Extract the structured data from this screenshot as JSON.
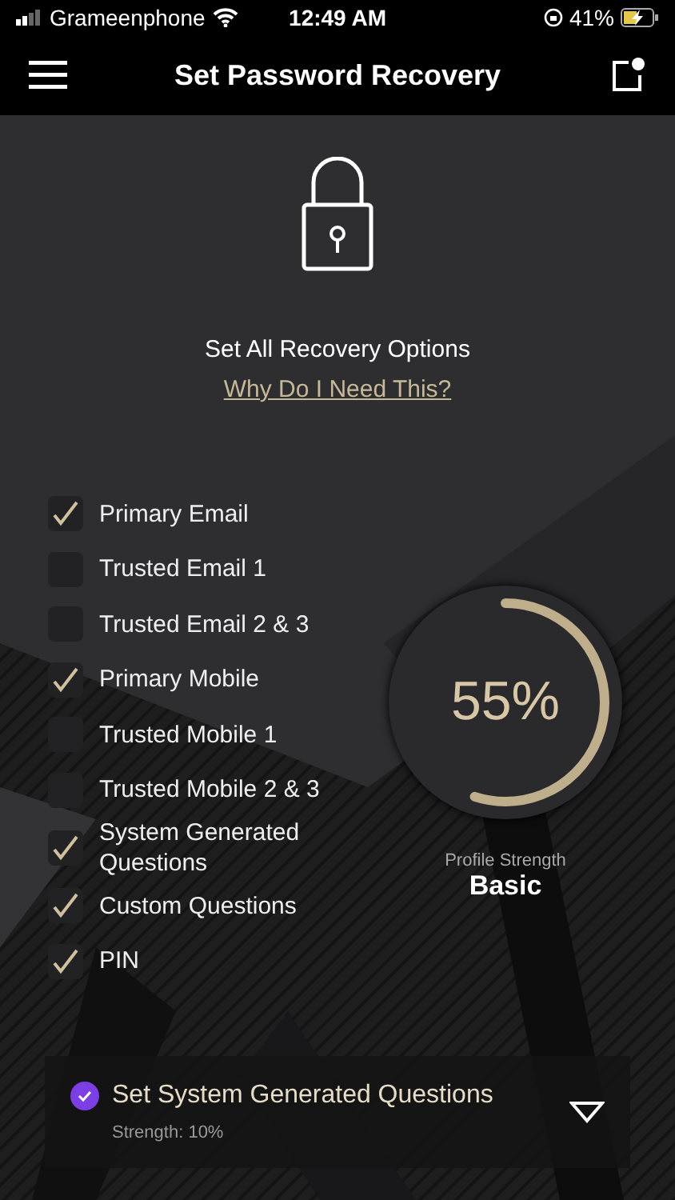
{
  "status_bar": {
    "carrier": "Grameenphone",
    "time": "12:49 AM",
    "battery": "41%"
  },
  "nav_bar": {
    "title": "Set Password Recovery"
  },
  "header": {
    "title": "Set All Recovery Options",
    "link": "Why Do I Need This?"
  },
  "options": [
    {
      "label": "Primary Email",
      "checked": true
    },
    {
      "label": "Trusted Email 1",
      "checked": false
    },
    {
      "label": "Trusted Email 2 & 3",
      "checked": false
    },
    {
      "label": "Primary Mobile",
      "checked": true
    },
    {
      "label": "Trusted Mobile 1",
      "checked": false
    },
    {
      "label": "Trusted Mobile 2 & 3",
      "checked": false
    },
    {
      "label": "System Generated Questions",
      "checked": true
    },
    {
      "label": "Custom Questions",
      "checked": true
    },
    {
      "label": "PIN",
      "checked": true
    }
  ],
  "profile_strength": {
    "level": 0.55,
    "percent": "55%",
    "caption": "Profile Strength",
    "rating": "Basic"
  },
  "next_step": {
    "title": "Set System Generated Questions",
    "strength": "Strength: 10%",
    "done": true
  }
}
